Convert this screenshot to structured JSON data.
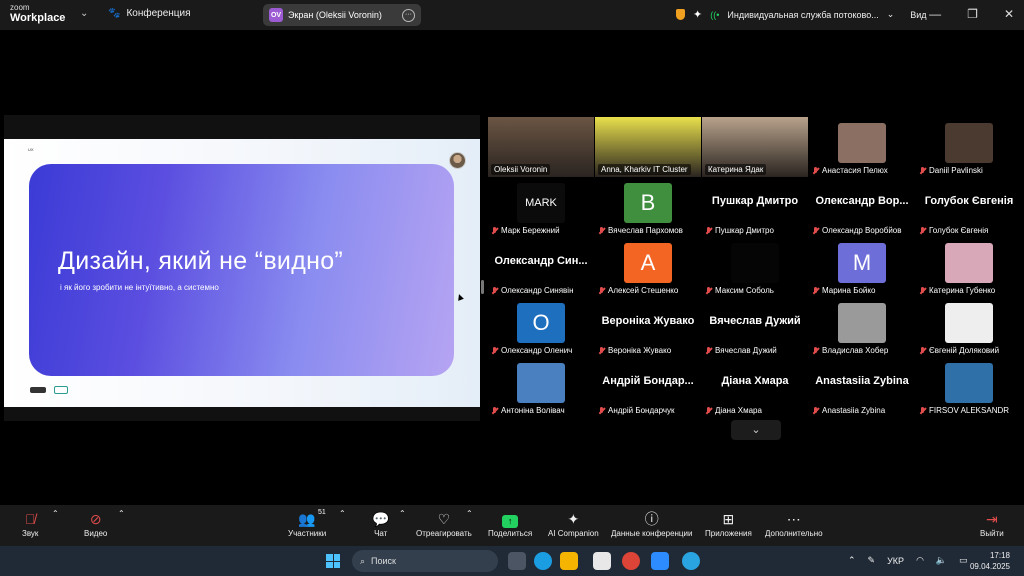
{
  "titlebar": {
    "logo_line1": "zoom",
    "logo_line2": "Workplace",
    "meeting_label": "Конференция",
    "share_badge": "OV",
    "share_label": "Экран (Oleksii Voronin)",
    "stream_label": "Индивидуальная служба потоково...",
    "view_label": "Вид",
    "minimize": "—",
    "restore": "❐",
    "close": "✕"
  },
  "slide": {
    "tag": "UX",
    "title": "Дизайн, який не “видно”",
    "subtitle": "і як його зробити не інтуїтивно, а системно"
  },
  "gallery": {
    "tiles": [
      {
        "name": "Oleksii Voronin",
        "type": "video",
        "active": true,
        "muted": false,
        "color": "#6b5544"
      },
      {
        "name": "Anna, Kharkiv IT Cluster",
        "type": "video",
        "active": false,
        "muted": false,
        "color": "#e9e04c"
      },
      {
        "name": "Катерина Ядак",
        "type": "video",
        "active": false,
        "muted": false,
        "color": "#b8a28c"
      },
      {
        "name": "Анастасия Пелюх",
        "type": "photo",
        "muted": true,
        "color": "#8a6f62"
      },
      {
        "name": "Daniil Pavlinski",
        "type": "photo",
        "muted": true,
        "color": "#4a3a30"
      },
      {
        "name": "Марк Бережний",
        "type": "avatar",
        "muted": true,
        "letter": "MARK",
        "color": "#0b0b0b"
      },
      {
        "name": "Вячеслав Пархомов",
        "type": "avatar",
        "muted": true,
        "letter": "B",
        "color": "#3f8f3f"
      },
      {
        "name": "Пушкар Дмитро",
        "type": "text",
        "muted": true,
        "big": "Пушкар Дмитро"
      },
      {
        "name": "Олександр Воробйов",
        "type": "text",
        "muted": true,
        "big": "Олександр Вор..."
      },
      {
        "name": "Голубок Євгенія",
        "type": "text",
        "muted": true,
        "big": "Голубок Євгенія"
      },
      {
        "name": "Олександр Синявін",
        "type": "text",
        "muted": true,
        "big": "Олександр Син..."
      },
      {
        "name": "Алексей Стешенко",
        "type": "avatar",
        "muted": true,
        "letter": "A",
        "color": "#f26522"
      },
      {
        "name": "Максим Соболь",
        "type": "avatar",
        "muted": true,
        "letter": "",
        "color": "#050505"
      },
      {
        "name": "Марина Бойко",
        "type": "avatar",
        "muted": true,
        "letter": "M",
        "color": "#6e6ed8"
      },
      {
        "name": "Катерина Губенко",
        "type": "photo",
        "muted": true,
        "color": "#d9a8b8"
      },
      {
        "name": "Олександр Оленич",
        "type": "avatar",
        "muted": true,
        "letter": "O",
        "color": "#1f6fbf"
      },
      {
        "name": "Вероніка Жувако",
        "type": "text",
        "muted": true,
        "big": "Вероніка Жувако"
      },
      {
        "name": "Вячеслав Дужий",
        "type": "text",
        "muted": true,
        "big": "Вячеслав Дужий"
      },
      {
        "name": "Владислав Хобер",
        "type": "photo",
        "muted": true,
        "color": "#9a9a9a"
      },
      {
        "name": "Євгеній Доляковий",
        "type": "photo",
        "muted": true,
        "color": "#eeeeee"
      },
      {
        "name": "Антоніна Волівач",
        "type": "photo",
        "muted": true,
        "color": "#4a80c0"
      },
      {
        "name": "Андрій Бондарчук",
        "type": "text",
        "muted": true,
        "big": "Андрій Бондар..."
      },
      {
        "name": "Діана Хмара",
        "type": "text",
        "muted": true,
        "big": "Діана Хмара"
      },
      {
        "name": "Anastasiia Zybina",
        "type": "text",
        "muted": true,
        "big": "Anastasiia Zybina"
      },
      {
        "name": "FIRSOV ALEKSANDR",
        "type": "photo",
        "muted": true,
        "color": "#3070a8"
      }
    ],
    "scroll_down_icon": "chevron-down-icon"
  },
  "controls": {
    "audio": "Звук",
    "video": "Видео",
    "participants": "Участники",
    "participants_count": "51",
    "chat": "Чат",
    "react": "Отреагировать",
    "share": "Поделиться",
    "ai": "AI Companion",
    "meeting_info": "Данные конференции",
    "apps": "Приложения",
    "more": "Дополнительно",
    "leave": "Выйти"
  },
  "taskbar": {
    "search_placeholder": "Поиск",
    "lang": "УКР",
    "time": "17:18",
    "date": "09.04.2025"
  },
  "colors": {
    "accent_green": "#23d160",
    "mute_red": "#e14c4c",
    "bg": "#000000"
  }
}
